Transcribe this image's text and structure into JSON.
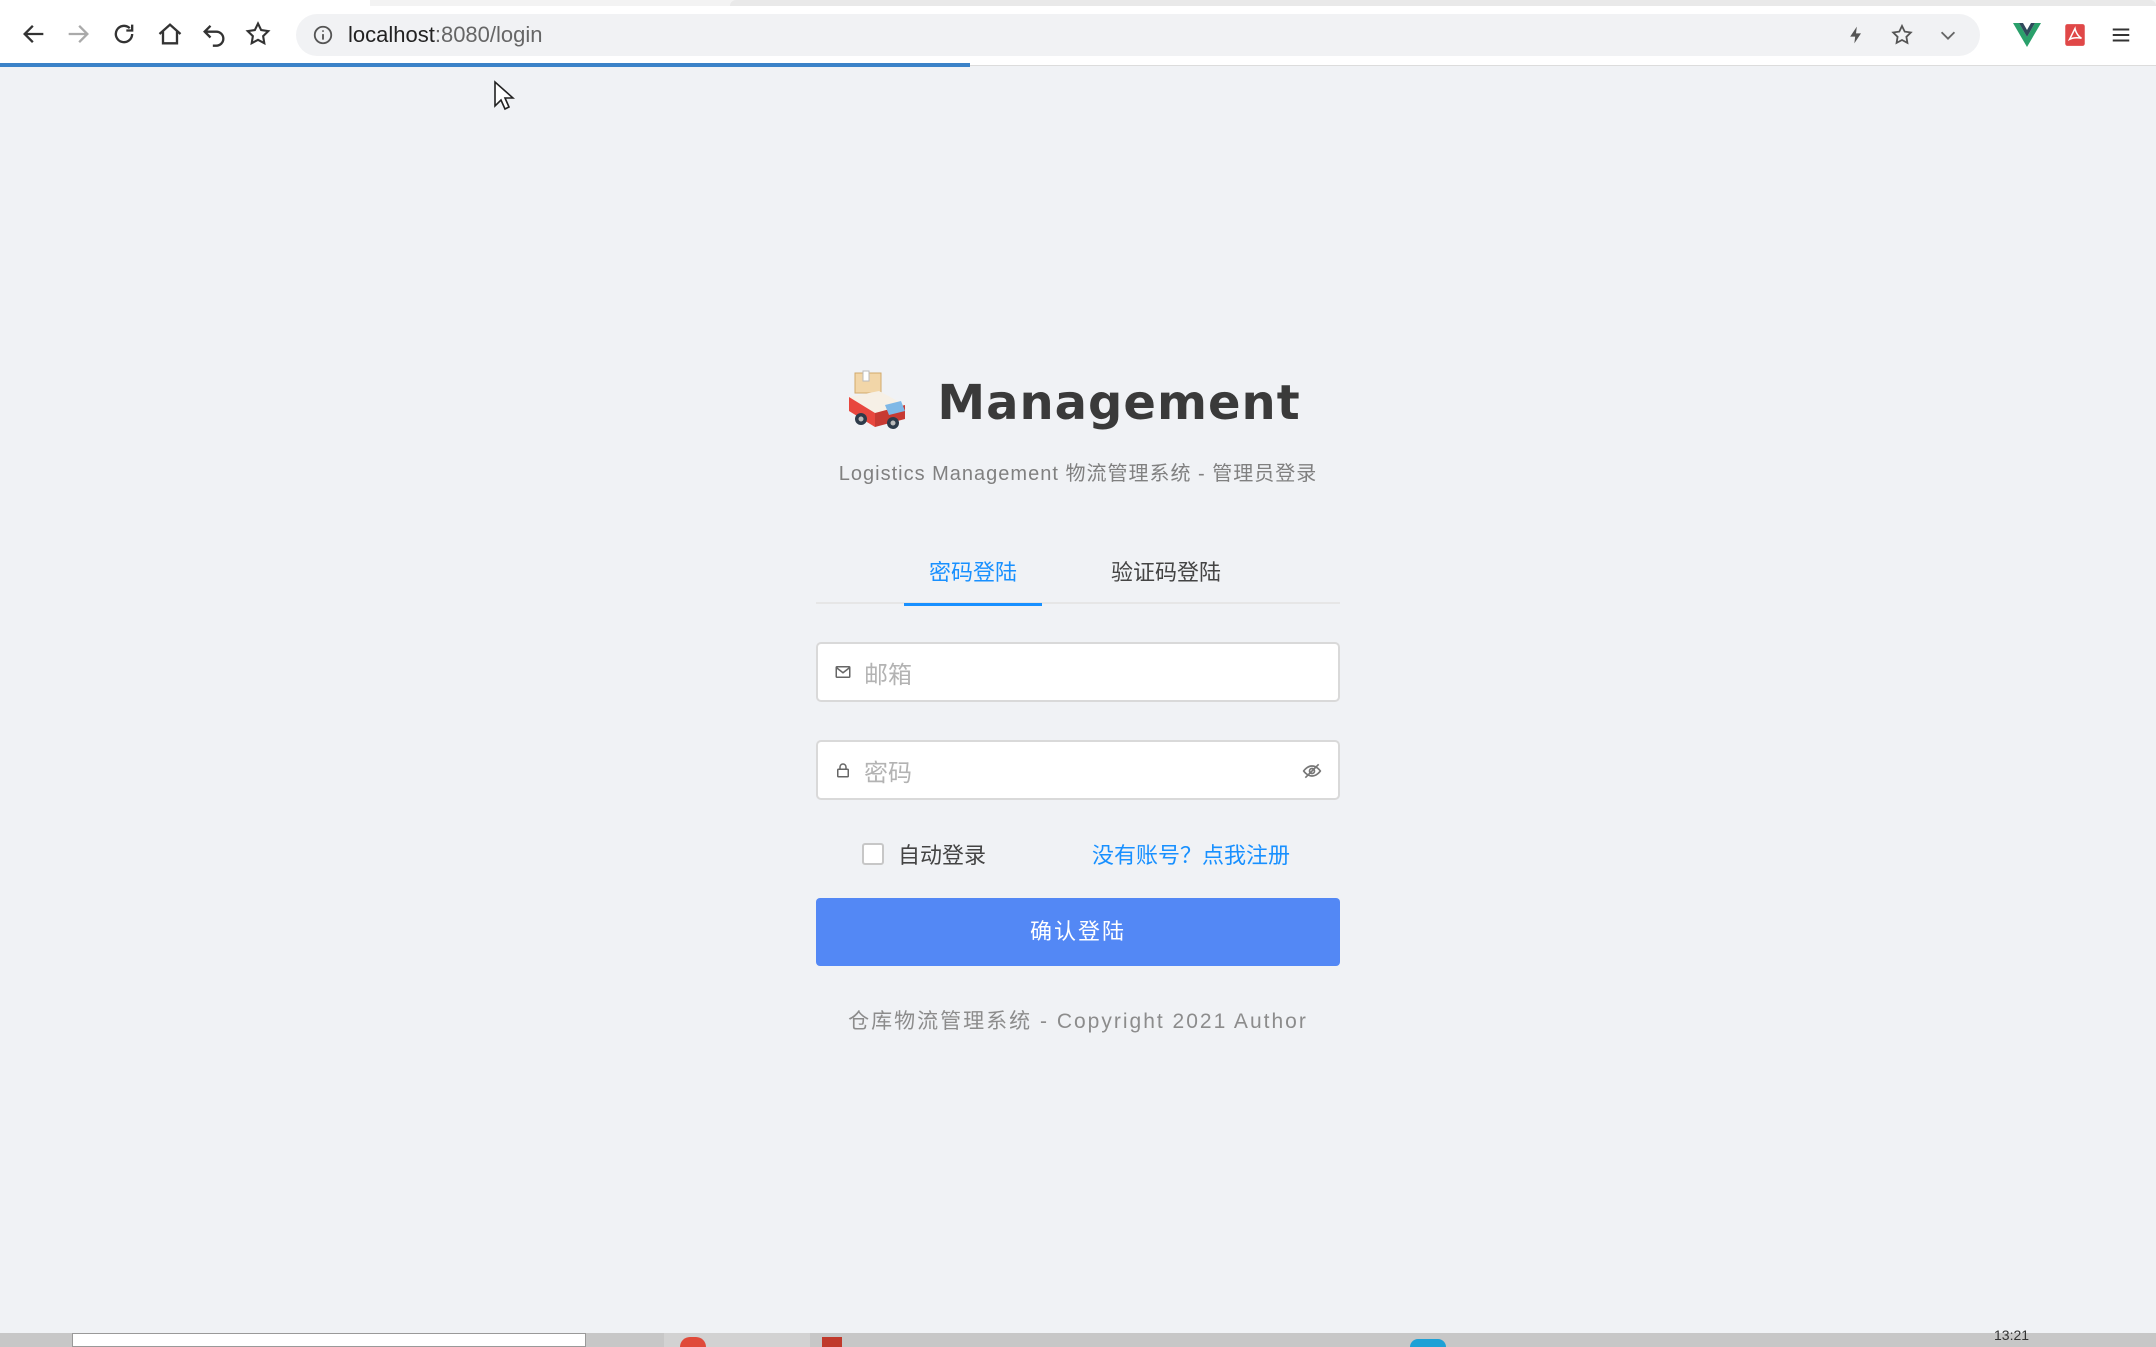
{
  "browser": {
    "url_host": "localhost",
    "url_rest": ":8080/login",
    "icons": [
      "back-icon",
      "forward-icon",
      "reload-icon",
      "home-icon",
      "undo-icon",
      "star-icon",
      "info-icon",
      "lightning-icon",
      "bookmark-star-icon",
      "chevron-down-icon",
      "vue-devtools-icon",
      "pdf-icon",
      "menu-icon"
    ],
    "load_progress_percent": 45
  },
  "brand": {
    "title": "Management",
    "subtitle": "Logistics Management 物流管理系统 - 管理员登录"
  },
  "tabs": [
    {
      "label": "密码登陆",
      "active": true
    },
    {
      "label": "验证码登陆",
      "active": false
    }
  ],
  "form": {
    "email_placeholder": "邮箱",
    "password_placeholder": "密码",
    "auto_login_label": "自动登录",
    "auto_login_checked": false,
    "register_link": "没有账号？点我注册",
    "submit_label": "确认登陆"
  },
  "footer": {
    "text": "仓库物流管理系统 - Copyright 2021 Author"
  },
  "taskbar": {
    "clock": "13:21"
  },
  "colors": {
    "accent": "#1890ff",
    "button": "#5388f5",
    "page_bg": "#f0f2f5"
  }
}
